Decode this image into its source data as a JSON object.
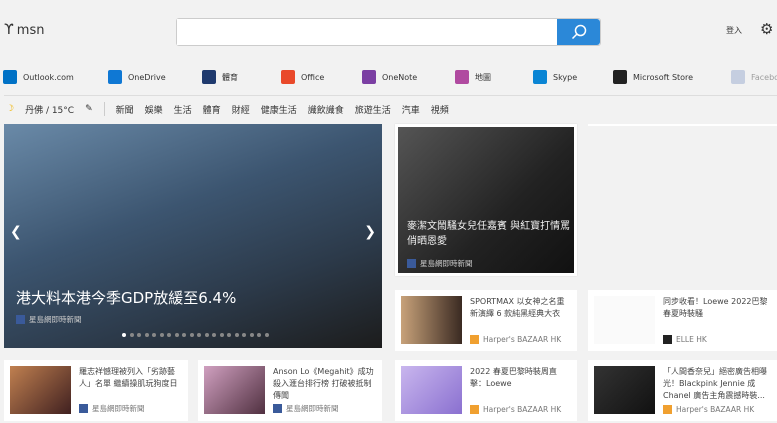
{
  "header": {
    "logo": "msn",
    "search_placeholder": "",
    "sign_in": "登入"
  },
  "quick_links": [
    {
      "label": "Outlook.com",
      "icon": "outlook-icon",
      "color": "#0072c6"
    },
    {
      "label": "OneDrive",
      "icon": "onedrive-icon",
      "color": "#0f78d4"
    },
    {
      "label": "體育",
      "icon": "sports-icon",
      "color": "#1f3a6e"
    },
    {
      "label": "Office",
      "icon": "office-icon",
      "color": "#e9492a"
    },
    {
      "label": "OneNote",
      "icon": "onenote-icon",
      "color": "#7b3fa3"
    },
    {
      "label": "地圖",
      "icon": "maps-icon",
      "color": "#b04aa0"
    },
    {
      "label": "Skype",
      "icon": "skype-icon",
      "color": "#0a85d4"
    },
    {
      "label": "Microsoft Store",
      "icon": "store-icon",
      "color": "#222"
    },
    {
      "label": "Facebook",
      "icon": "facebook-icon",
      "color": "#8fa4cc"
    }
  ],
  "weather": {
    "location": "丹佛 / 15°C"
  },
  "nav": [
    "新聞",
    "娛樂",
    "生活",
    "體育",
    "財經",
    "健康生活",
    "識飲識食",
    "旅遊生活",
    "汽車",
    "視頻"
  ],
  "hero": {
    "title": "港大料本港今季GDP放緩至6.4%",
    "source": "星島網即時新聞",
    "slides": 20,
    "active_slide": 1
  },
  "feature": {
    "title": "麥潔文鬧騷女兒任嘉賓 與紅寶打情罵俏晒恩愛",
    "source": "星島網即時新聞"
  },
  "cards": [
    {
      "title": "SPORTMAX 以女神之名重新演繹 6 款純黑經典大衣",
      "source": "Harper's BAZAAR HK"
    },
    {
      "title": "同步收看！Loewe 2022巴黎春夏時裝騷",
      "source": "ELLE HK"
    },
    {
      "title": "羅志祥憾理被列入「劣跡藝人」名單 繼續操肌玩狗度日",
      "source": "星島網即時新聞"
    },
    {
      "title": "Anson Lo《Megahit》成功殺入滙台排行榜 打破被抵制傳聞",
      "source": "星島網即時新聞"
    },
    {
      "title": "2022 春夏巴黎時裝周直擊：Loewe",
      "source": "Harper's BAZAAR HK"
    },
    {
      "title": "「人間香奈兒」絕密廣告相曝光！Blackpink Jennie 成Chanel 廣告主角震撼時裝...",
      "source": "Harper's BAZAAR HK"
    }
  ]
}
